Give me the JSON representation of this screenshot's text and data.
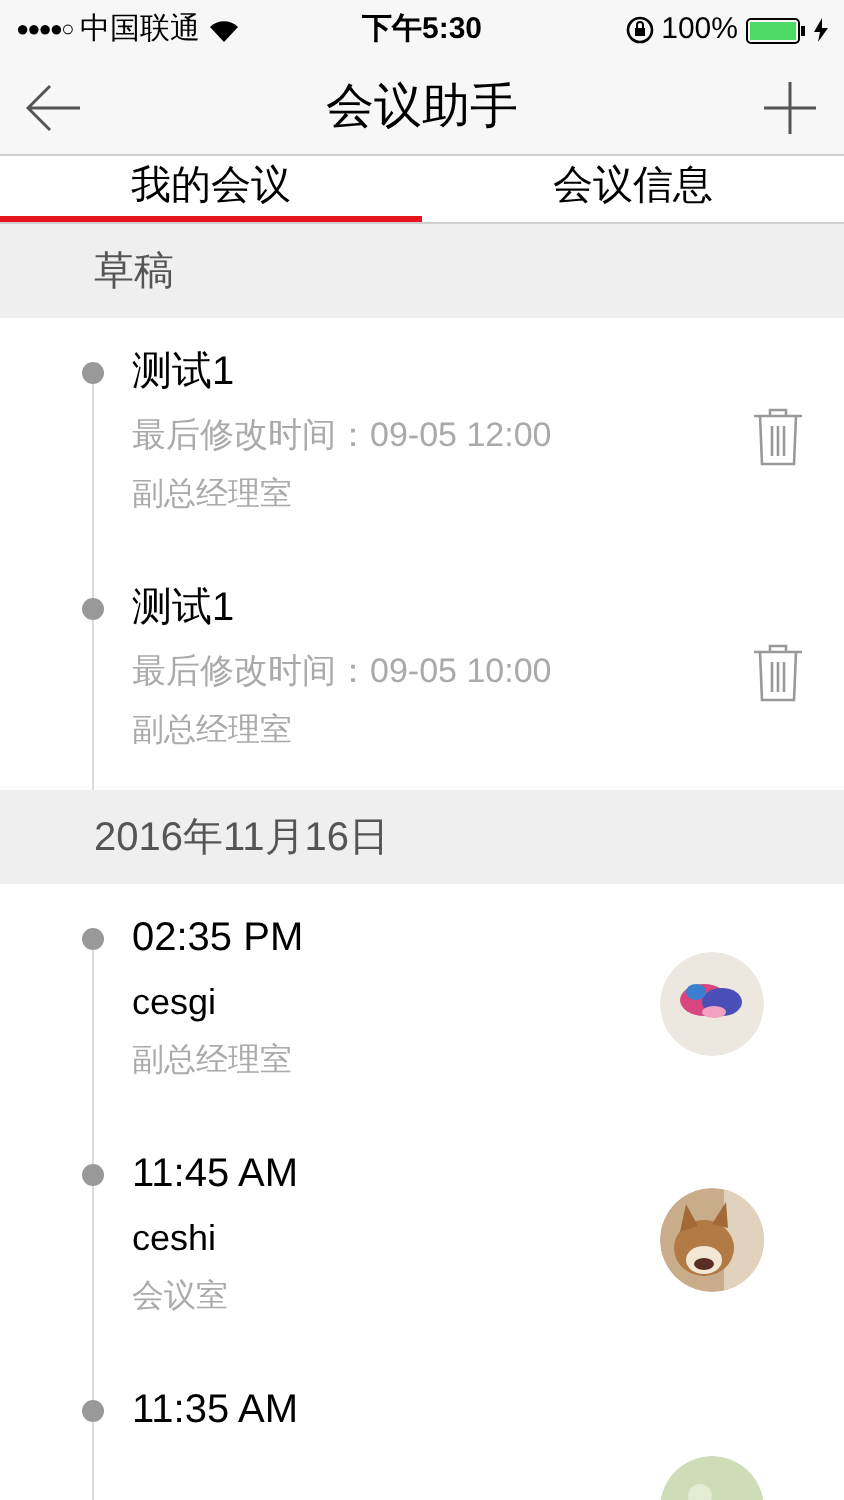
{
  "status_bar": {
    "signal": "●●●●○",
    "carrier": "中国联通",
    "time": "下午5:30",
    "battery": "100%"
  },
  "nav": {
    "title": "会议助手"
  },
  "tabs": [
    {
      "label": "我的会议",
      "selected": true
    },
    {
      "label": "会议信息",
      "selected": false
    }
  ],
  "sections": [
    {
      "header": "草稿",
      "items": [
        {
          "kind": "draft",
          "title": "测试1",
          "modified": "最后修改时间：09-05 12:00",
          "room": "副总经理室"
        },
        {
          "kind": "draft",
          "title": "测试1",
          "modified": "最后修改时间：09-05 10:00",
          "room": "副总经理室"
        }
      ]
    },
    {
      "header": "2016年11月16日",
      "items": [
        {
          "kind": "meeting",
          "time": "02:35 PM",
          "name": "cesgi",
          "room": "副总经理室"
        },
        {
          "kind": "meeting",
          "time": "11:45 AM",
          "name": "ceshi",
          "room": "会议室"
        },
        {
          "kind": "meeting",
          "time": "11:35 AM"
        }
      ]
    }
  ]
}
